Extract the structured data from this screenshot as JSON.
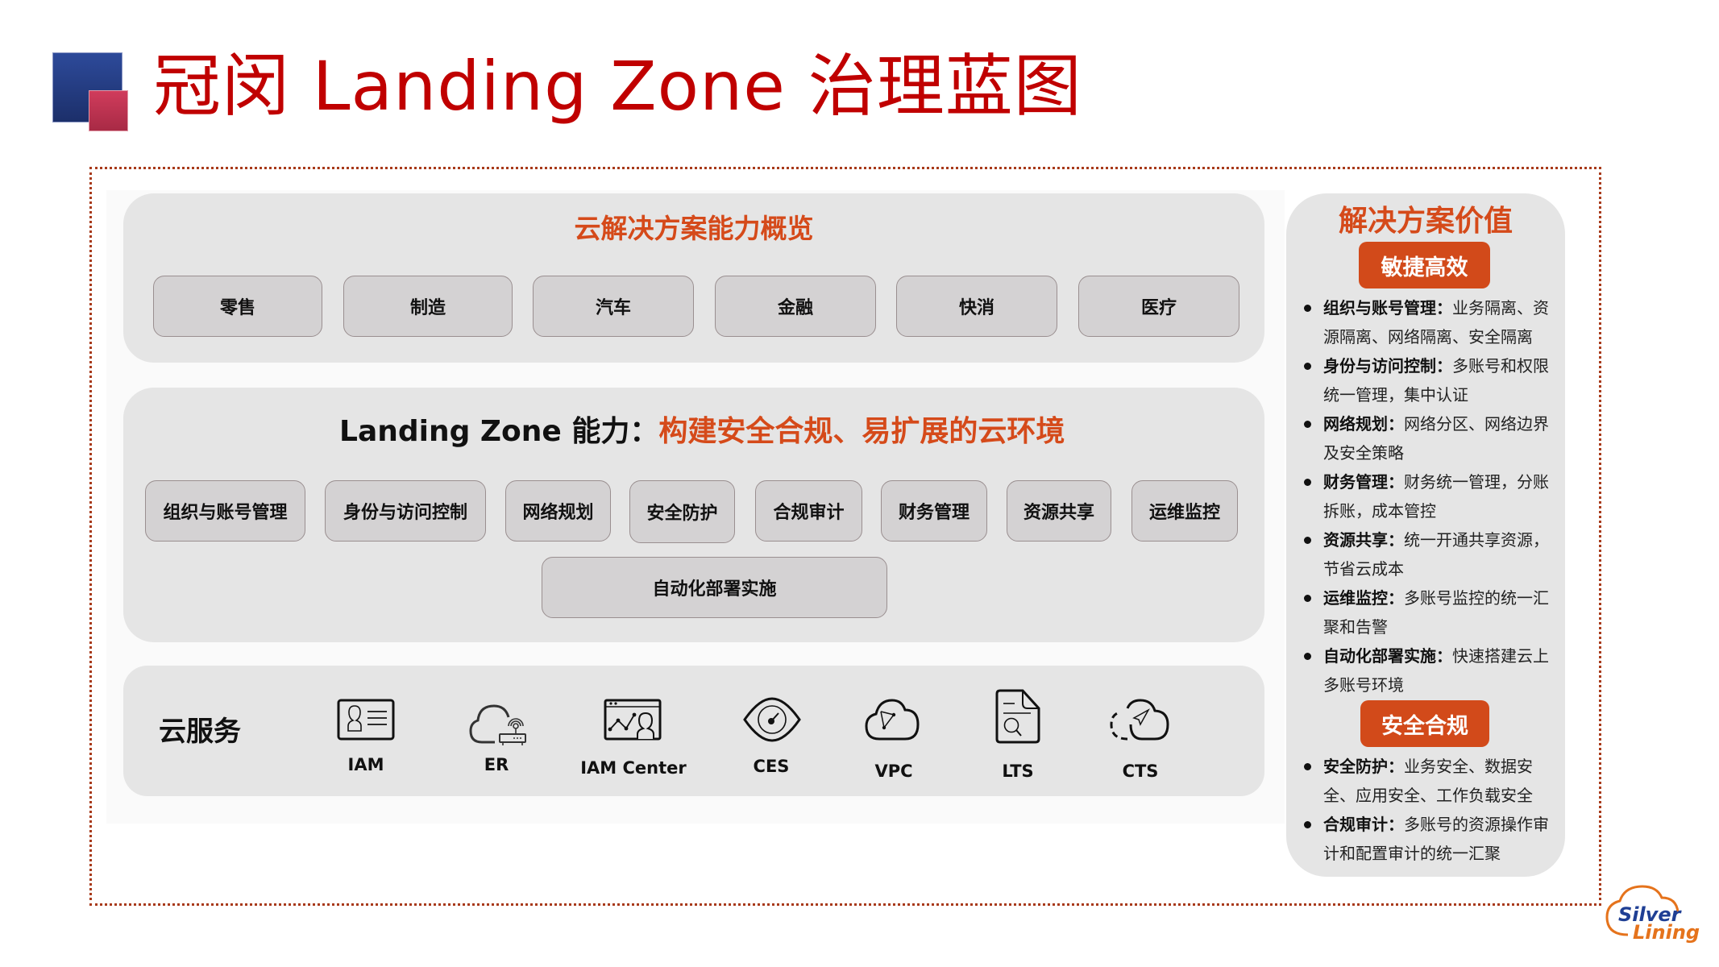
{
  "header": {
    "title": "冠闵 Landing Zone 治理蓝图"
  },
  "overview": {
    "title": "云解决方案能力概览",
    "industries": [
      "零售",
      "制造",
      "汽车",
      "金融",
      "快消",
      "医疗"
    ]
  },
  "capabilities": {
    "title_prefix": "Landing Zone 能力：",
    "title_highlight": "构建安全合规、易扩展的云环境",
    "items": [
      "组织与账号管理",
      "身份与访问控制",
      "网络规划",
      "安全防护",
      "合规审计",
      "财务管理",
      "资源共享",
      "运维监控"
    ],
    "wide_item": "自动化部署实施"
  },
  "cloud_services": {
    "label": "云服务",
    "items": [
      {
        "name": "IAM",
        "icon": "id-card-icon"
      },
      {
        "name": "ER",
        "icon": "cloud-router-icon"
      },
      {
        "name": "IAM Center",
        "icon": "dashboard-user-icon"
      },
      {
        "name": "CES",
        "icon": "eye-gauge-icon"
      },
      {
        "name": "VPC",
        "icon": "cloud-network-icon"
      },
      {
        "name": "LTS",
        "icon": "log-search-icon"
      },
      {
        "name": "CTS",
        "icon": "cloud-trace-icon"
      }
    ]
  },
  "value_panel": {
    "title": "解决方案价值",
    "groups": [
      {
        "badge": "敏捷高效",
        "bullets": [
          {
            "term": "组织与账号管理：",
            "desc": "业务隔离、资源隔离、网络隔离、安全隔离"
          },
          {
            "term": "身份与访问控制：",
            "desc": "多账号和权限统一管理，集中认证"
          },
          {
            "term": "网络规划：",
            "desc": "网络分区、网络边界及安全策略"
          },
          {
            "term": "财务管理：",
            "desc": "财务统一管理，分账拆账，成本管控"
          },
          {
            "term": "资源共享：",
            "desc": "统一开通共享资源，节省云成本"
          },
          {
            "term": "运维监控：",
            "desc": "多账号监控的统一汇聚和告警"
          },
          {
            "term": "自动化部署实施：",
            "desc": "快速搭建云上多账号环境"
          }
        ]
      },
      {
        "badge": "安全合规",
        "bullets": [
          {
            "term": "安全防护：",
            "desc": "业务安全、数据安全、应用安全、工作负载安全"
          },
          {
            "term": "合规审计：",
            "desc": "多账号的资源操作审计和配置审计的统一汇聚"
          }
        ]
      }
    ]
  },
  "brand": {
    "line1": "Silver",
    "line2": "Lining"
  },
  "colors": {
    "title_red": "#c00000",
    "accent_orange": "#d54a1a",
    "panel_gray": "#e5e5e5",
    "pill_gray": "#d4d2d3",
    "brand_blue": "#1f3f94",
    "brand_orange": "#e5731c"
  }
}
